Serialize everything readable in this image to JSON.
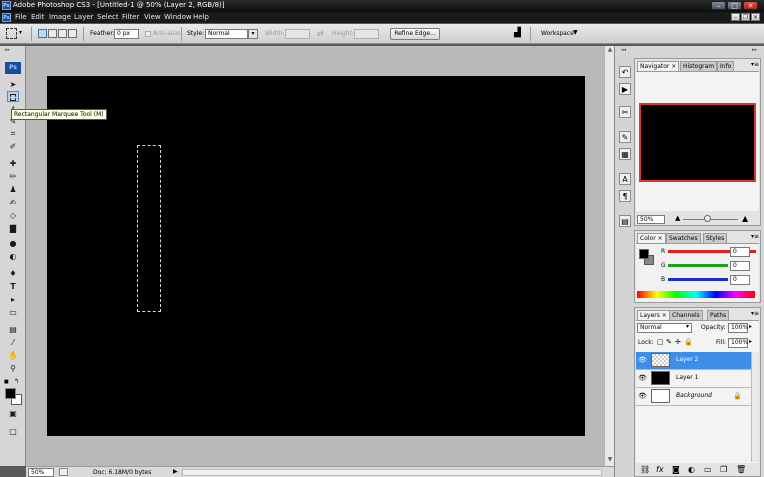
{
  "window": {
    "title": "Adobe Photoshop CS3 - [Untitled-1 @ 50% (Layer 2, RGB/8)]",
    "app_badge": "Ps"
  },
  "menu": {
    "items": [
      "File",
      "Edit",
      "Image",
      "Layer",
      "Select",
      "Filter",
      "View",
      "Window",
      "Help"
    ]
  },
  "options": {
    "feather_label": "Feather:",
    "feather_value": "0 px",
    "antialias_label": "Anti-alias",
    "style_label": "Style:",
    "style_value": "Normal",
    "width_label": "Width:",
    "height_label": "Height:",
    "refine_edge": "Refine Edge...",
    "workspace": "Workspace"
  },
  "toolbox": {
    "badge": "Ps",
    "tooltip": "Rectangular Marquee Tool (M)"
  },
  "status": {
    "zoom": "50%",
    "doc": "Doc: 6.18M/0 bytes"
  },
  "navigator": {
    "tabs": [
      "Navigator",
      "Histogram",
      "Info"
    ],
    "zoom": "50%"
  },
  "color": {
    "tabs": [
      "Color",
      "Swatches",
      "Styles"
    ],
    "r_label": "R",
    "g_label": "G",
    "b_label": "B",
    "r": "0",
    "g": "0",
    "b": "0",
    "accent_red": "#e02020",
    "accent_green": "#1aa01a",
    "accent_blue": "#1a30c8"
  },
  "layers": {
    "tabs": [
      "Layers",
      "Channels",
      "Paths"
    ],
    "blend_mode": "Normal",
    "opacity_label": "Opacity:",
    "opacity": "100%",
    "lock_label": "Lock:",
    "fill_label": "Fill:",
    "fill": "100%",
    "items": [
      {
        "name": "Layer 2",
        "selected": true
      },
      {
        "name": "Layer 1",
        "selected": false
      },
      {
        "name": "Background",
        "selected": false
      }
    ],
    "selection_color": "#3d8ee8"
  }
}
